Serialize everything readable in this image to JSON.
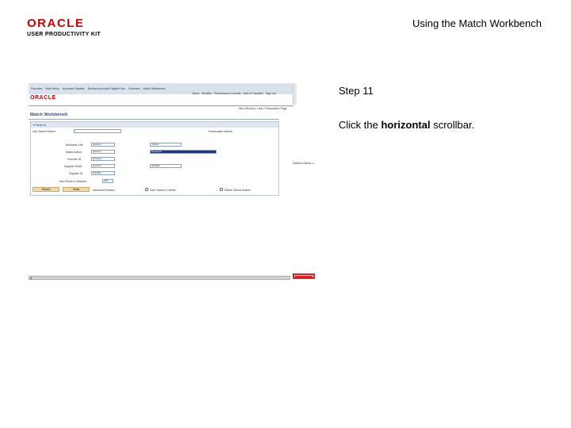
{
  "logo": {
    "brand": "ORACLE",
    "product": "USER PRODUCTIVITY KIT"
  },
  "header": {
    "title": "Using the Match Workbench"
  },
  "step": {
    "title": "Step 11",
    "instruction_prefix": "Click the ",
    "instruction_bold": "horizontal",
    "instruction_suffix": " scrollbar."
  },
  "screenshot": {
    "nav_items": [
      "Favorites",
      "Main Menu",
      "Accounts Payable",
      "Review Accounts Payable Info",
      "Vouchers",
      "Match Workbench"
    ],
    "brand": "ORACLE",
    "top_links": [
      "Home",
      "Worklist",
      "Performance Console",
      "Add to Favorites",
      "Sign out"
    ],
    "sub_links": [
      "New Window",
      "Help",
      "Personalize Page"
    ],
    "page_heading": "Match Workbench",
    "panel_title": "Search",
    "fields": {
      "saved_search_label": "Use Saved Search",
      "business_unit_label": "Business Unit",
      "business_unit_op": "equal to",
      "business_unit_value": "US001",
      "match_action_label": "Match Action",
      "match_action_op": "equal to",
      "match_action_value": "Exception",
      "voucher_id_label": "Voucher ID",
      "voucher_id_op": "between",
      "supplier_id_label": "Supplier SetID",
      "supplier_id_op": "equal to",
      "supplier_id_value": "SHARE",
      "name_label": "Supplier ID",
      "name_op": "between",
      "name_value": "SHARE",
      "max_rows_label": "Max Rows to Retrieve",
      "max_rows_value": "300",
      "personalize": "Personalize Search",
      "select_criteria": "Search criteria >>"
    },
    "buttons": {
      "search": "Search",
      "clear": "Clear",
      "advanced": "Advanced Search",
      "save": "Save Search Criteria",
      "delete": "Delete Saved Search"
    },
    "scroll_arrow": "◂"
  }
}
